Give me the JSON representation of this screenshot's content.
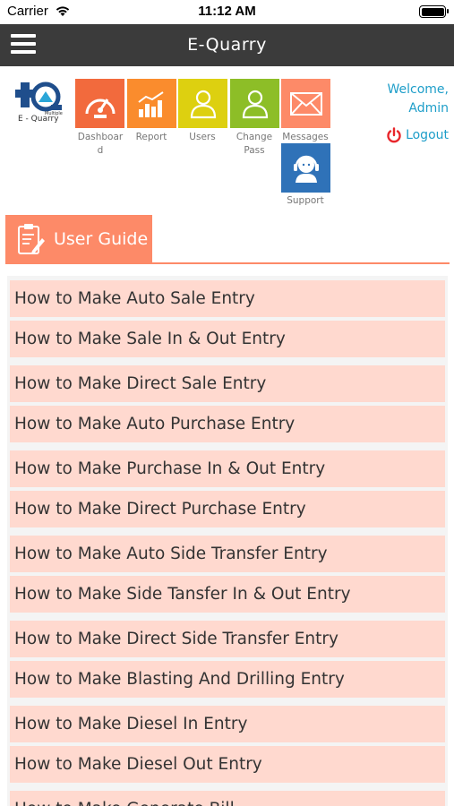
{
  "status_bar": {
    "carrier": "Carrier",
    "time": "11:12 AM"
  },
  "nav": {
    "title": "E-Quarry",
    "menu_icon": "hamburger-menu-icon"
  },
  "logo": {
    "text": "E - Quarry",
    "small_text": "Multiple"
  },
  "tiles": [
    {
      "label": "Dashboar d",
      "icon": "speedometer-icon",
      "color": "#f26a3d"
    },
    {
      "label": "Report",
      "icon": "bar-chart-icon",
      "color": "#fa8c2d"
    },
    {
      "label": "Users",
      "icon": "user-icon",
      "color": "#ddd010"
    },
    {
      "label": "Change Pass",
      "icon": "user-outline-icon",
      "color": "#8dbe27"
    },
    {
      "label": "Messages",
      "icon": "envelope-icon",
      "color": "#fd8a68"
    },
    {
      "label": "Support",
      "icon": "support-agent-icon",
      "color": "#2f72b8"
    }
  ],
  "user": {
    "welcome": "Welcome,",
    "name": "Admin",
    "logout": "Logout"
  },
  "section": {
    "title": "User Guide",
    "icon": "clipboard-icon"
  },
  "guides": [
    "How to Make Auto Sale Entry",
    "How to Make Sale In & Out Entry",
    "How to Make Direct Sale Entry",
    "How to Make Auto Purchase Entry",
    "How to Make Purchase In & Out Entry",
    "How to Make Direct Purchase Entry",
    "How to Make Auto Side Transfer Entry",
    "How to Make Side Tansfer In & Out Entry",
    "How to Make Direct Side Transfer Entry",
    "How to Make Blasting And Drilling Entry",
    "How to Make Diesel In Entry",
    "How to Make Diesel Out Entry",
    "How to Make Generate Bill"
  ],
  "colors": {
    "accent": "#fd8a68",
    "item_bg": "#ffd9cf",
    "nav_bg": "#3b3b3b",
    "link": "#1e9ec9"
  }
}
